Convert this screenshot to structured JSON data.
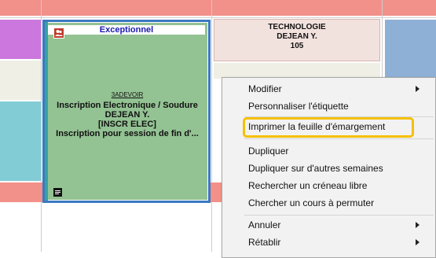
{
  "colors": {
    "header_row": "#f2908a",
    "card_green": "#93c293",
    "card_border": "#3b79c2",
    "card_title": "#1a1ab0",
    "highlight": "#f6c000"
  },
  "course_card": {
    "header": "Exceptionnel",
    "code": "3ADEVOIR",
    "title": "Inscription Electronique / Soudure",
    "teacher": "DEJEAN Y.",
    "group": "[INSCR ELEC]",
    "note": "Inscription pour session de fin d'...",
    "badge_icon": "people-icon",
    "note_icon": "note-icon"
  },
  "tech_card": {
    "subject": "TECHNOLOGIE",
    "teacher": "DEJEAN Y.",
    "room": "105"
  },
  "context_menu": {
    "items": [
      {
        "label": "Modifier",
        "submenu": true
      },
      {
        "label": "Personnaliser l'étiquette",
        "submenu": false
      },
      {
        "label": "Imprimer la feuille d'émargement",
        "submenu": false,
        "highlighted": true
      },
      {
        "label": "Dupliquer",
        "submenu": false
      },
      {
        "label": "Dupliquer sur d'autres semaines",
        "submenu": false
      },
      {
        "label": "Rechercher un créneau libre",
        "submenu": false
      },
      {
        "label": "Chercher un cours à permuter",
        "submenu": false
      },
      {
        "label": "Annuler",
        "submenu": true
      },
      {
        "label": "Rétablir",
        "submenu": true
      }
    ]
  }
}
